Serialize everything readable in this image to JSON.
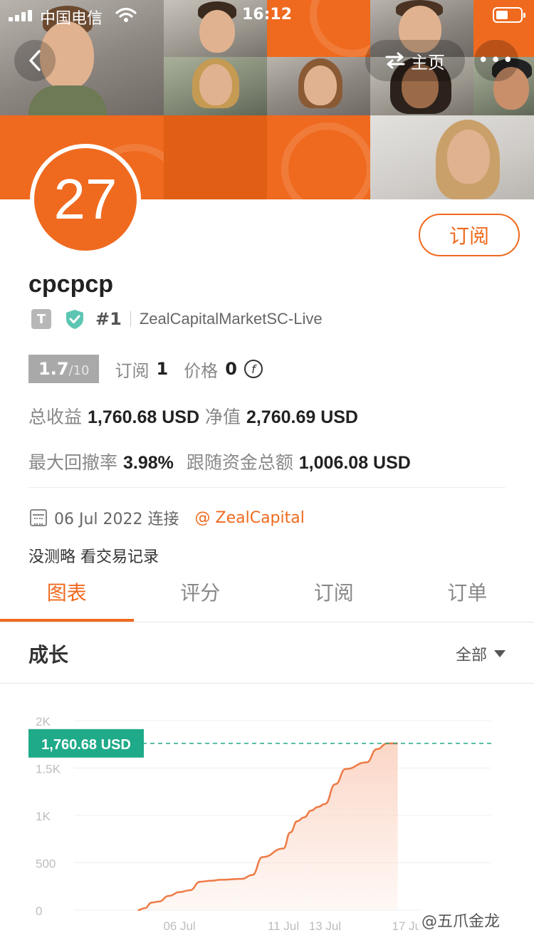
{
  "status_bar": {
    "carrier": "中国电信",
    "time": "16:12"
  },
  "nav": {
    "back_icon": "chevron-left-icon",
    "home_label": "主页",
    "home_icon": "swap-icon",
    "more_label": "•••"
  },
  "profile": {
    "avatar_text": "27",
    "subscribe_label": "订阅",
    "username": "cpcpcp",
    "badge_t": "T",
    "rank": "#1",
    "server": "ZealCapitalMarketSC-Live",
    "score_big": "1.7",
    "score_small": "/10",
    "subscribe_count_label": "订阅",
    "subscribe_count": "1",
    "price_label": "价格",
    "price_value": "0",
    "price_coin": "f"
  },
  "stats": {
    "total_profit_label": "总收益",
    "total_profit_value": "1,760.68 USD",
    "net_value_label": "净值",
    "net_value_value": "2,760.69 USD",
    "max_drawdown_label": "最大回撤率",
    "max_drawdown_value": "3.98%",
    "follow_total_label": "跟随资金总额",
    "follow_total_value": "1,006.08 USD"
  },
  "info": {
    "date_text": "06 Jul 2022 连接",
    "broker_text": "@ ZealCapital",
    "strategy_text": "没测略 看交易记录"
  },
  "tabs": [
    {
      "label": "图表",
      "active": true
    },
    {
      "label": "评分",
      "active": false
    },
    {
      "label": "订阅",
      "active": false
    },
    {
      "label": "订单",
      "active": false
    }
  ],
  "growth": {
    "title": "成长",
    "range_label": "全部"
  },
  "chart_data": {
    "type": "area",
    "title": "",
    "xlabel": "",
    "ylabel": "",
    "ylim": [
      0,
      2000
    ],
    "yticks": [
      "0",
      "500",
      "1K",
      "1.5K",
      "2K"
    ],
    "ytick_values": [
      0,
      500,
      1000,
      1500,
      2000
    ],
    "xticks": [
      "06 Jul",
      "11 Jul",
      "13 Jul",
      "17 Jul"
    ],
    "xtick_dates": [
      "2022-07-06",
      "2022-07-11",
      "2022-07-13",
      "2022-07-17"
    ],
    "current_label": "1,760.68 USD",
    "current_value": 1760.68,
    "grid": true,
    "colors": {
      "line": "#ee7a45",
      "fill": "#fbd5c4",
      "marker": "#1faa89"
    },
    "series": [
      {
        "x": [
          "2022-07-04",
          "2022-07-04",
          "2022-07-04",
          "2022-07-05",
          "2022-07-05",
          "2022-07-06",
          "2022-07-06",
          "2022-07-07",
          "2022-07-07",
          "2022-07-08",
          "2022-07-09",
          "2022-07-09",
          "2022-07-10",
          "2022-07-11",
          "2022-07-11",
          "2022-07-11",
          "2022-07-12",
          "2022-07-12",
          "2022-07-12",
          "2022-07-13",
          "2022-07-13",
          "2022-07-14",
          "2022-07-15",
          "2022-07-15",
          "2022-07-16",
          "2022-07-16"
        ],
        "values": [
          0,
          20,
          80,
          90,
          150,
          190,
          210,
          300,
          310,
          320,
          330,
          370,
          560,
          650,
          820,
          940,
          980,
          1050,
          1090,
          1120,
          1330,
          1490,
          1560,
          1700,
          1760,
          1760
        ]
      }
    ]
  },
  "watermark": "@五爪金龙"
}
